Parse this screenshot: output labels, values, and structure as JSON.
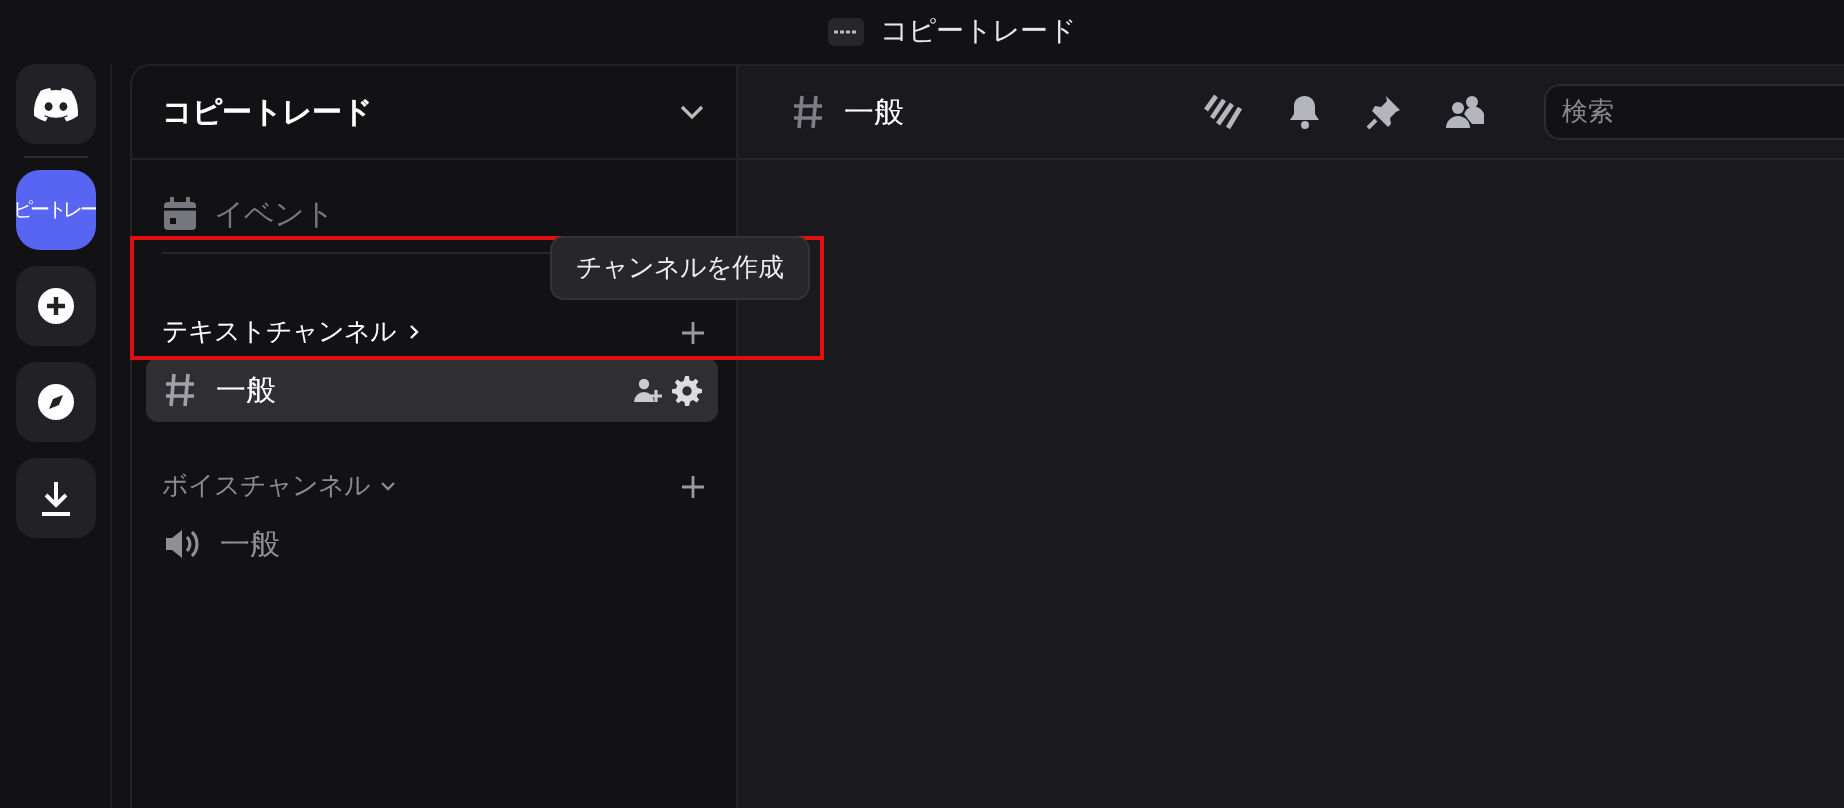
{
  "title_bar": {
    "server_name": "コピートレード"
  },
  "server_rail": [
    {
      "kind": "home"
    },
    {
      "kind": "server",
      "label": "ピートレー"
    },
    {
      "kind": "add"
    },
    {
      "kind": "discover"
    },
    {
      "kind": "download"
    }
  ],
  "sidebar": {
    "server_name": "コピートレード",
    "event_label": "イベント",
    "categories": [
      {
        "name": "テキストチャンネル",
        "expanded": false,
        "hovered": true,
        "channels": [
          {
            "kind": "text",
            "name": "一般",
            "selected": true
          }
        ]
      },
      {
        "name": "ボイスチャンネル",
        "expanded": true,
        "hovered": false,
        "channels": [
          {
            "kind": "voice",
            "name": "一般",
            "selected": false
          }
        ]
      }
    ]
  },
  "tooltip": "チャンネルを作成",
  "channel_header": {
    "name": "一般",
    "search": {
      "placeholder": "検索"
    }
  }
}
